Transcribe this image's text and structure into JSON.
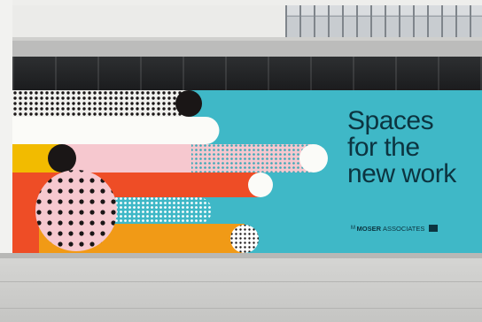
{
  "billboard": {
    "headline_lines": [
      "Spaces",
      "for the",
      "new work"
    ],
    "logo_mark": "M",
    "logo_bold": "MOSER",
    "logo_regular": "ASSOCIATES"
  },
  "colors": {
    "billboard_bg": "#3fb8c7",
    "headline": "#0c3440",
    "orange": "#ee4d26",
    "pink": "#f6c8cf",
    "yellow": "#f2bb00",
    "amber": "#f19a16",
    "teal": "#3fb8c7",
    "black": "#1a1616",
    "white": "#fbfbf8"
  }
}
